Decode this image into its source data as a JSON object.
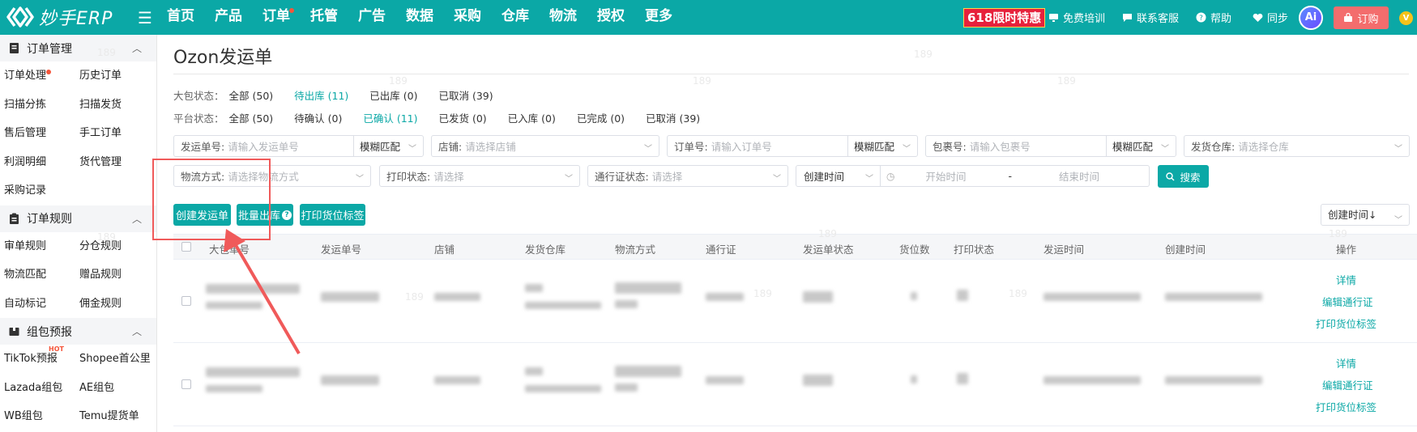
{
  "brand": {
    "logo_text": "妙手ERP"
  },
  "top_nav": [
    "首页",
    "产品",
    "订单",
    "托管",
    "广告",
    "数据",
    "采购",
    "仓库",
    "物流",
    "授权",
    "更多"
  ],
  "top_right": {
    "promo": "618限时特惠",
    "training": "免费培训",
    "support": "联系客服",
    "help": "帮助",
    "sync": "同步",
    "ai": "Ai",
    "order": "订购",
    "vip": "V"
  },
  "sidebar": {
    "groups": [
      {
        "title": "订单管理",
        "items": [
          "订单处理",
          "历史订单",
          "扫描分拣",
          "扫描发货",
          "售后管理",
          "手工订单",
          "利润明细",
          "货代管理",
          "采购记录"
        ]
      },
      {
        "title": "订单规则",
        "items": [
          "审单规则",
          "分仓规则",
          "物流匹配",
          "赠品规则",
          "自动标记",
          "佣金规则"
        ]
      },
      {
        "title": "组包预报",
        "items": [
          "TikTok预报",
          "Shopee首公里",
          "Lazada组包",
          "AE组包",
          "WB组包",
          "Temu提货单"
        ]
      }
    ],
    "hot_tag": "HOT"
  },
  "page": {
    "title": "Ozon发运单",
    "package_status": {
      "label": "大包状态：",
      "options": [
        "全部 (50)",
        "待出库 (11)",
        "已出库 (0)",
        "已取消 (39)"
      ],
      "active_index": 1
    },
    "platform_status": {
      "label": "平台状态：",
      "options": [
        "全部 (50)",
        "待确认 (0)",
        "已确认 (11)",
        "已发货 (0)",
        "已入库 (0)",
        "已完成 (0)",
        "已取消 (39)"
      ],
      "active_index": 2
    }
  },
  "filters": {
    "shipment_no": {
      "label": "发运单号:",
      "placeholder": "请输入发运单号",
      "match": "模糊匹配"
    },
    "store": {
      "label": "店铺:",
      "placeholder": "请选择店铺"
    },
    "order_no": {
      "label": "订单号:",
      "placeholder": "请输入订单号",
      "match": "模糊匹配"
    },
    "package_no": {
      "label": "包裹号:",
      "placeholder": "请输入包裹号",
      "match": "模糊匹配"
    },
    "warehouse": {
      "label": "发货仓库:",
      "placeholder": "请选择仓库"
    },
    "logistics": {
      "label": "物流方式:",
      "placeholder": "请选择物流方式"
    },
    "print_status": {
      "label": "打印状态:",
      "placeholder": "请选择"
    },
    "pass_status": {
      "label": "通行证状态:",
      "placeholder": "请选择"
    },
    "time_type": "创建时间",
    "start_time": "开始时间",
    "range_sep": "-",
    "end_time": "结束时间",
    "search": "搜索"
  },
  "actions": {
    "create": "创建发运单",
    "batch_out": "批量出库",
    "print_label": "打印货位标签",
    "sort": "创建时间↓"
  },
  "table": {
    "columns": [
      "大包单号",
      "发运单号",
      "店铺",
      "发货仓库",
      "物流方式",
      "通行证",
      "发运单状态",
      "货位数",
      "打印状态",
      "发运时间",
      "创建时间",
      "操作"
    ],
    "row_actions": [
      "详情",
      "编辑通行证",
      "打印货位标签"
    ],
    "row_count": 2
  },
  "watermark": "189",
  "colors": {
    "brand": "#0ba8a6",
    "promo": "#e7213c",
    "order_button": "#f36d6d",
    "highlight": "#f05a5a"
  }
}
